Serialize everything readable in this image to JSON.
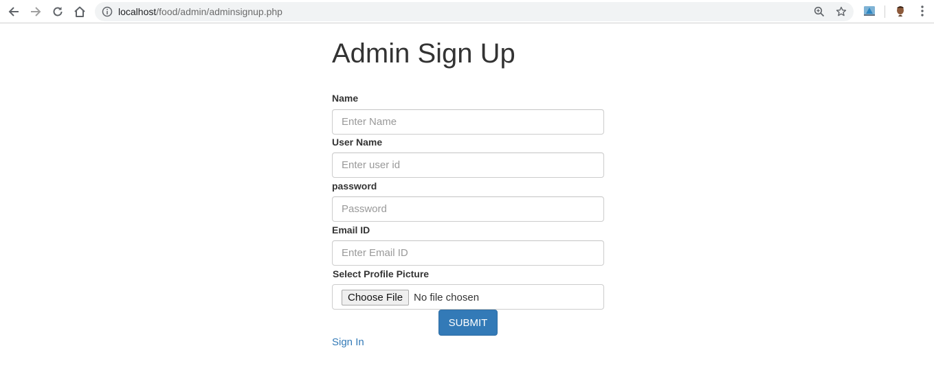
{
  "browser": {
    "url_host": "localhost",
    "url_path": "/food/admin/adminsignup.php"
  },
  "page": {
    "title": "Admin Sign Up"
  },
  "form": {
    "name": {
      "label": "Name",
      "placeholder": "Enter Name",
      "value": ""
    },
    "username": {
      "label": "User Name",
      "placeholder": "Enter user id",
      "value": ""
    },
    "password": {
      "label": "password",
      "placeholder": "Password",
      "value": ""
    },
    "email": {
      "label": "Email ID",
      "placeholder": "Enter Email ID",
      "value": ""
    },
    "picture": {
      "label": "Select Profile Picture",
      "button_label": "Choose File",
      "status": "No file chosen"
    },
    "submit_label": "SUBMIT",
    "signin_label": "Sign In"
  },
  "colors": {
    "primary": "#337ab7",
    "text": "#333333",
    "placeholder": "#999999"
  }
}
